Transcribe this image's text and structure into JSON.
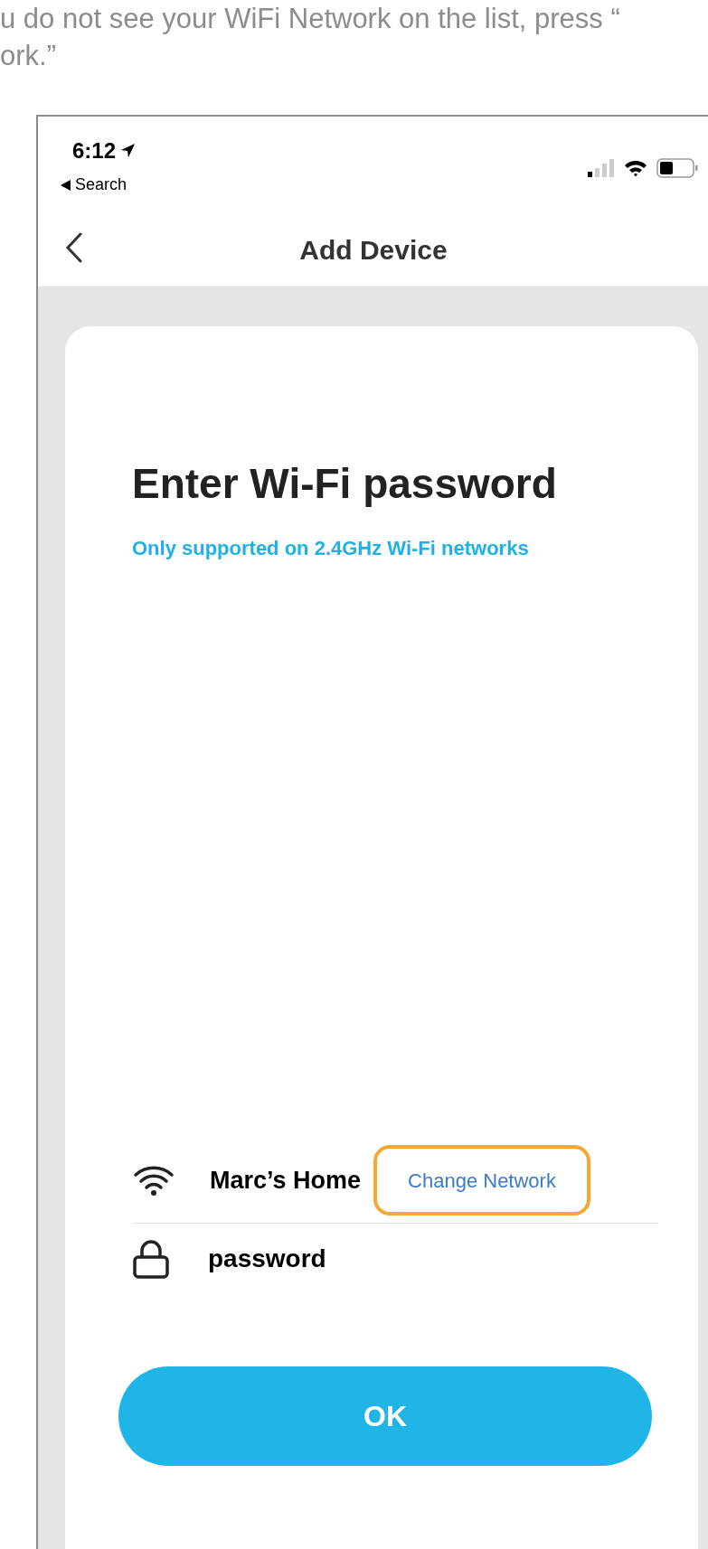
{
  "caption": {
    "lines": [
      "u do not see your WiFi Network on the list, press “",
      "ork.”"
    ]
  },
  "status_bar": {
    "time": "6:12",
    "back_label": "Search"
  },
  "nav": {
    "title": "Add Device"
  },
  "card": {
    "title": "Enter Wi-Fi password",
    "note": "Only supported on 2.4GHz Wi-Fi networks",
    "network": {
      "name": "Marc’s Home",
      "action": "Change Network",
      "highlighted": true
    },
    "password": {
      "value": "password"
    },
    "button": "OK"
  }
}
